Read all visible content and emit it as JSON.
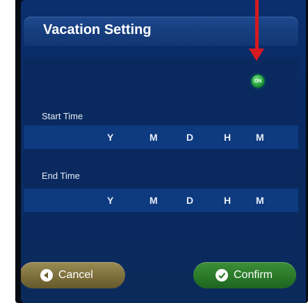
{
  "dialog": {
    "title": "Vacation Setting"
  },
  "toggle": {
    "state_label": "ON"
  },
  "start_time": {
    "label": "Start Time",
    "fields": [
      "Y",
      "M",
      "D",
      "H",
      "M"
    ]
  },
  "end_time": {
    "label": "End Time",
    "fields": [
      "Y",
      "M",
      "D",
      "H",
      "M"
    ]
  },
  "buttons": {
    "cancel_label": "Cancel",
    "confirm_label": "Confirm"
  },
  "colors": {
    "annotation_arrow": "#d71920",
    "toggle_on": "#25a33b"
  }
}
